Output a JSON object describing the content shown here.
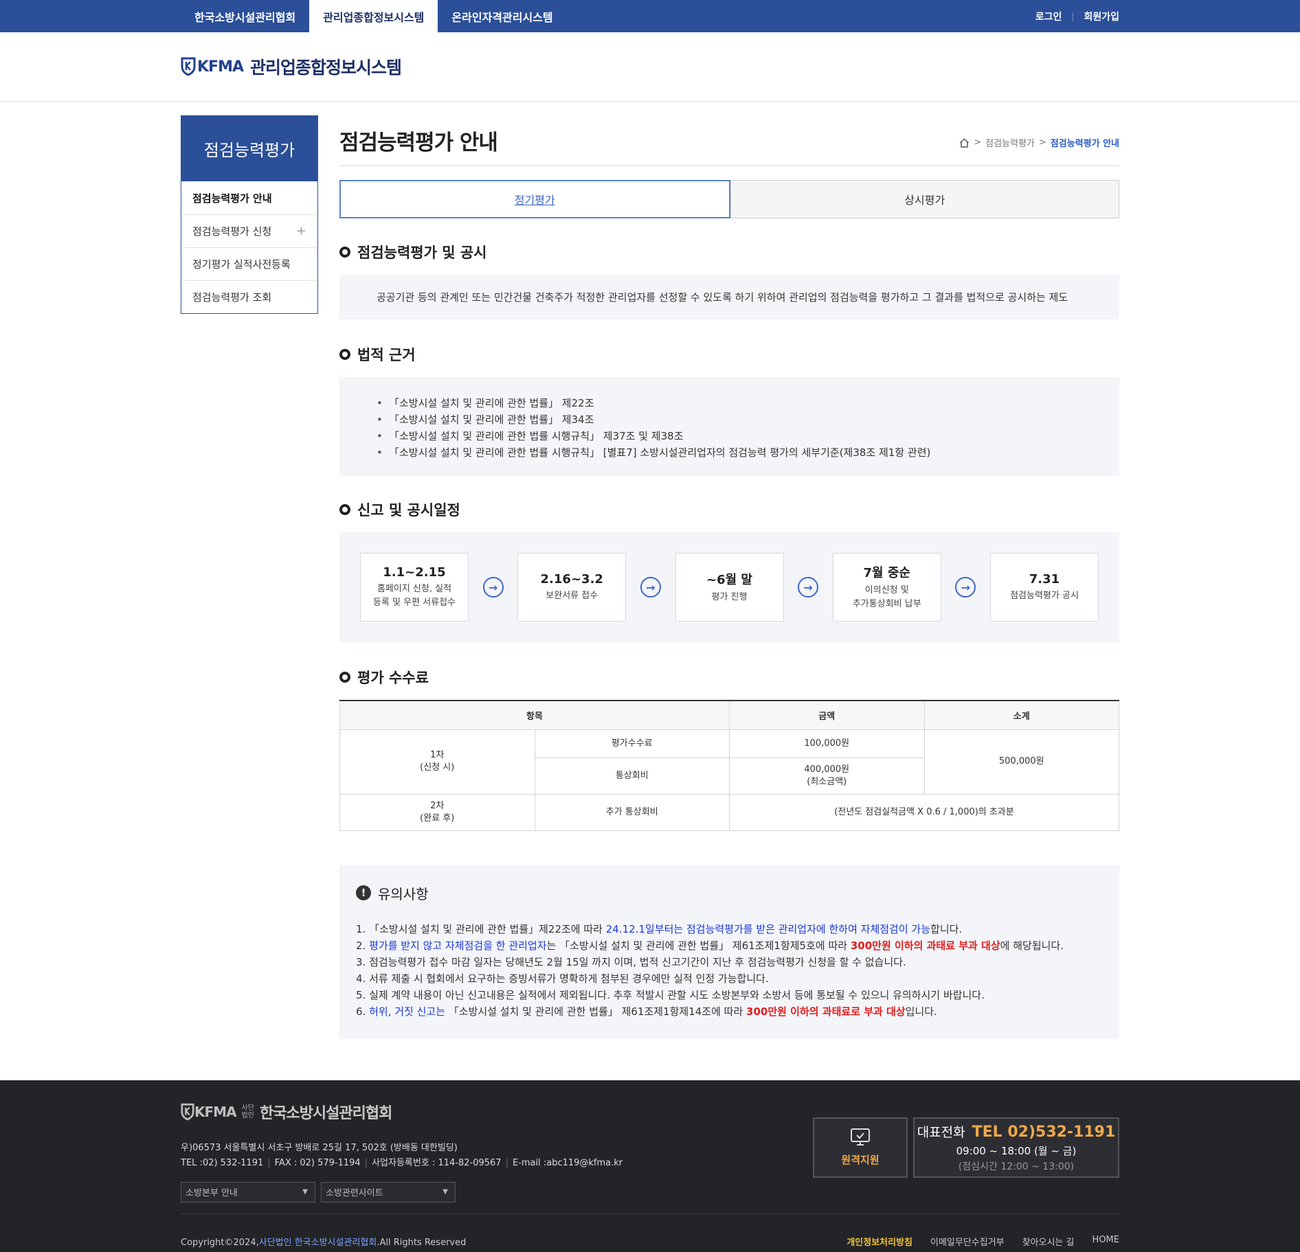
{
  "topbar": {
    "tabs": [
      "한국소방시설관리협회",
      "관리업종합정보시스템",
      "온라인자격관리시스템"
    ],
    "login": "로그인",
    "signup": "회원가입"
  },
  "header": {
    "logo_mark": "KFMA",
    "title": "관리업종합정보시스템"
  },
  "sidebar": {
    "title": "점검능력평가",
    "items": [
      {
        "label": "점검능력평가 안내"
      },
      {
        "label": "점검능력평가 신청"
      },
      {
        "label": "정기평가 실적사전등록"
      },
      {
        "label": "점검능력평가 조회"
      }
    ]
  },
  "page": {
    "title": "점검능력평가 안내",
    "breadcrumb": [
      "점검능력평가",
      "점검능력평가 안내"
    ]
  },
  "tabs": [
    "정기평가",
    "상시평가"
  ],
  "sections": {
    "s1_title": "점검능력평가 및 공시",
    "s1_text": "공공기관 등의 관계인 또는 민간건물 건축주가 적정한 관리업자를 선정할 수 있도록 하기 위하여 관리업의 점검능력을 평가하고 그 결과를 법적으로 공시하는 제도",
    "s2_title": "법적 근거",
    "s2_items": [
      "「소방시설 설치 및 관리에 관한 법률」 제22조",
      "「소방시설 설치 및 관리에 관한 법률」 제34조",
      "「소방시설 설치 및 관리에 관한 법률 시행규칙」 제37조 및 제38조",
      "「소방시설 설치 및 관리에 관한 법률 시행규칙」 [별표7] 소방시설관리업자의 점검능력 평가의 세부기준(제38조 제1항 관련)"
    ],
    "s3_title": "신고 및 공시일정",
    "s4_title": "평가 수수료"
  },
  "schedule": [
    {
      "date": "1.1~2.15",
      "desc1": "홈페이지 신청, 실적",
      "desc2": "등록 및 우편 서류접수"
    },
    {
      "date": "2.16~3.2",
      "desc1": "보완서류 접수",
      "desc2": ""
    },
    {
      "date": "~6월 말",
      "desc1": "평가 진행",
      "desc2": ""
    },
    {
      "date": "7월 중순",
      "desc1": "이의신청 및",
      "desc2": "추가통상회비 납부"
    },
    {
      "date": "7.31",
      "desc1": "점검능력평가 공시",
      "desc2": ""
    }
  ],
  "fee_table": {
    "headers": [
      "항목",
      "금액",
      "소계"
    ],
    "row1_label1": "1차",
    "row1_label2": "(신청 시)",
    "row1a_item": "평가수수료",
    "row1a_amount": "100,000원",
    "row1b_item": "통상회비",
    "row1b_amount1": "400,000원",
    "row1b_amount2": "(최소금액)",
    "row1_subtotal": "500,000원",
    "row2_label1": "2차",
    "row2_label2": "(완료 후)",
    "row2_item": "추가 통상회비",
    "row2_amount": "(전년도 점검실적금액 X 0.6 / 1,000)의 초과분"
  },
  "notice": {
    "title": "유의사항",
    "n1a": "1. 「소방시설 설치 및 관리에 관한 법률」제22조에 따라 ",
    "n1b": "24.12.1일부터는 점검능력평가를 받은 관리업자에 한하여 자체점검이 가능",
    "n1c": "합니다.",
    "n2a": "2. ",
    "n2b": "평가를 받지 않고 자체점검을 한 관리업자",
    "n2c": "는 「소방시설 설치 및 관리에 관한 법률」 제61조제1항제5호에 따라 ",
    "n2d": "300만원 이하의 과태료 부과 대상",
    "n2e": "에 해당됩니다.",
    "n3": "3. 점검능력평가 접수 마감 일자는 당해년도 2월 15일 까지 이며, 법적 신고기간이 지난 후 점검능력평가 신청을 할 수 없습니다.",
    "n4": "4. 서류 제출 시 협회에서 요구하는 증빙서류가 명확하게 첨부된 경우에만 실적 인정 가능합니다.",
    "n5": "5. 실제 계약 내용이 아닌 신고내용은 실적에서 제외됩니다. 추후 적발시 관할 시도 소방본부와 소방서 등에 통보될 수 있으니 유의하시기 바랍니다.",
    "n6a": "6. ",
    "n6b": "허위, 거짓 신고는",
    "n6c": " 「소방시설 설치 및 관리에 관한 법률」 제61조제1항제14조에 따라 ",
    "n6d": "300만원 이하의 과태료로 부과 대상",
    "n6e": "입니다."
  },
  "footer": {
    "logo_mark": "KFMA",
    "logo_small1": "사단",
    "logo_small2": "법인",
    "org_name": "한국소방시설관리협회",
    "address": "우)06573 서울특별시 서초구 방배로 25길 17, 502호 (방배동 대한빌딩)",
    "tel": "TEL :02) 532-1191",
    "fax": "FAX : 02) 579-1194",
    "bizno": "사업자등록번호 : 114-82-09567",
    "email": "E-mail :abc119@kfma.kr",
    "select1": "소방본부 안내",
    "select2": "소방관련사이트",
    "remote": "원격지원",
    "tel_label": "대표전화",
    "tel_number": "TEL 02)532-1191",
    "hours": "09:00 ~ 18:00 (월 ~ 금)",
    "lunch": "(점심시간 12:00 ~ 13:00)",
    "copyright_a": "Copyright©2024,",
    "copyright_b": "사단법인 한국소방시설관리협회",
    "copyright_c": ".All Rights Reserved",
    "links": [
      "개인정보처리방침",
      "이메일무단수집거부",
      "찾아오시는 길",
      "HOME"
    ]
  }
}
